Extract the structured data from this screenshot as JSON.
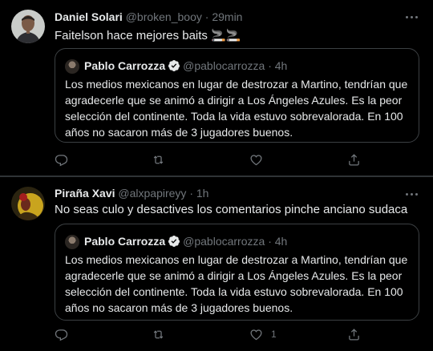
{
  "tweets": [
    {
      "author_name": "Daniel Solari",
      "handle": "@broken_booy",
      "separator": "·",
      "time": "29min",
      "text": "Faitelson hace mejores baits 🚬🚬",
      "quote": {
        "author_name": "Pablo Carrozza",
        "handle": "@pablocarrozza",
        "separator": "·",
        "time": "4h",
        "lines": [
          "Los medios mexicanos en lugar de destrozar a Martino, tendrían que",
          "agradecerle que se animó a dirigir a Los Ángeles Azules. Es la peor",
          "selección del continente. Toda la vida estuvo sobrevalorada. En 100",
          "años no sacaron más de 3 jugadores buenos."
        ]
      },
      "actions": {
        "reply_count": "",
        "retweet_count": "",
        "like_count": ""
      }
    },
    {
      "author_name": "Piraña Xavi",
      "handle": "@alxpapireyy",
      "separator": "·",
      "time": "1h",
      "text": "No seas culo y desactives los comentarios pinche anciano sudaca",
      "quote": {
        "author_name": "Pablo Carrozza",
        "handle": "@pablocarrozza",
        "separator": "·",
        "time": "4h",
        "lines": [
          "Los medios mexicanos en lugar de destrozar a Martino, tendrían que",
          "agradecerle que se animó a dirigir a Los Ángeles Azules. Es la peor",
          "selección del continente. Toda la vida estuvo sobrevalorada. En 100",
          "años no sacaron más de 3 jugadores buenos."
        ]
      },
      "actions": {
        "reply_count": "",
        "retweet_count": "",
        "like_count": "1"
      }
    }
  ],
  "icons": {
    "more": "more-horizontal-icon",
    "reply": "reply-icon",
    "retweet": "retweet-icon",
    "like": "heart-icon",
    "share": "share-icon",
    "verified": "verified-badge-icon"
  },
  "colors": {
    "background": "#000000",
    "text": "#e7e9ea",
    "muted": "#71767b",
    "border": "#2f3336",
    "verified": "#1d9bf0"
  }
}
